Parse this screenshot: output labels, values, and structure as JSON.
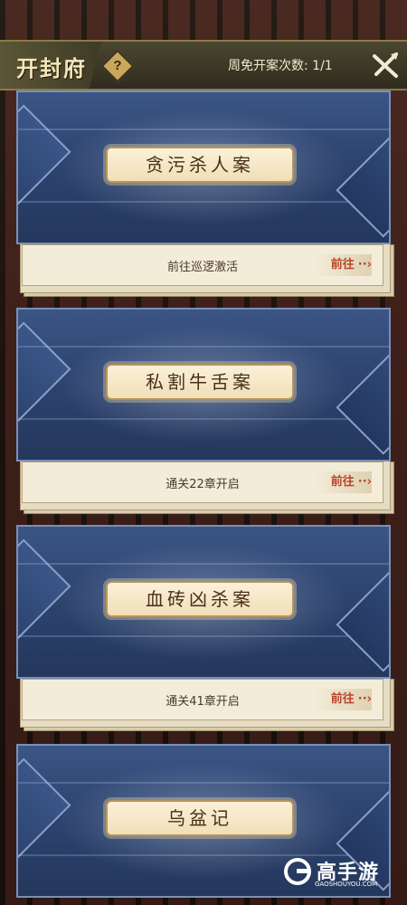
{
  "header": {
    "title": "开封府",
    "help_label": "?",
    "free_count": "周免开案次数: 1/1"
  },
  "cases": [
    {
      "name": "贪污杀人案",
      "unlock": "前往巡逻激活",
      "goto_label": "前往"
    },
    {
      "name": "私割牛舌案",
      "unlock": "通关22章开启",
      "goto_label": "前往"
    },
    {
      "name": "血砖凶杀案",
      "unlock": "通关41章开启",
      "goto_label": "前往"
    },
    {
      "name": "乌盆记",
      "unlock": "",
      "goto_label": ""
    }
  ],
  "watermark": {
    "brand": "高手游",
    "domain": "GAOSHOUYOU.COM"
  },
  "colors": {
    "card_blue": "#2f4672",
    "plate_cream": "#f0dfb8",
    "goto_red": "#b8452a",
    "title_gold": "#f4e6b8"
  }
}
